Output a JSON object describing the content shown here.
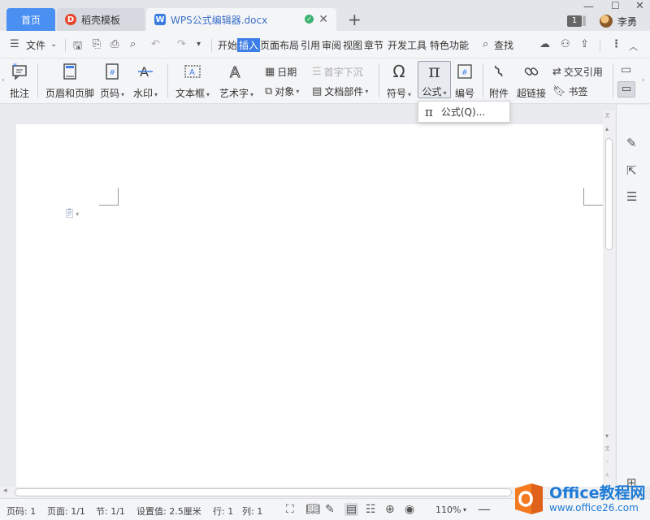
{
  "titlebar": {
    "tabs": [
      {
        "label": "首页"
      },
      {
        "label": "稻壳模板"
      },
      {
        "label": "WPS公式编辑器.docx"
      }
    ],
    "new_tab": "+",
    "badge": "1",
    "user_name": "李勇"
  },
  "menubar": {
    "file": "文件",
    "tabs": [
      "开始",
      "插入",
      "页面布局",
      "引用",
      "审阅",
      "视图",
      "章节",
      "开发工具",
      "特色功能"
    ],
    "active_tab": "插入",
    "search": "查找"
  },
  "ribbon": {
    "items": {
      "comment": "批注",
      "header_footer": "页眉和页脚",
      "page_number": "页码",
      "watermark": "水印",
      "textbox": "文本框",
      "wordart": "艺术字",
      "date": "日期",
      "object": "对象",
      "drop_cap": "首字下沉",
      "doc_parts": "文档部件",
      "symbol": "符号",
      "formula": "公式",
      "numbering": "编号",
      "attachment": "附件",
      "hyperlink": "超链接",
      "cross_reference": "交叉引用",
      "bookmark": "书签"
    }
  },
  "dropdown": {
    "item": "公式(Q)..."
  },
  "statusbar": {
    "page": "页码: 1",
    "pages": "页面: 1/1",
    "section": "节: 1/1",
    "setting": "设置值: 2.5厘米",
    "row": "行: 1",
    "col": "列: 1",
    "zoom": "110%"
  },
  "watermark": {
    "line1": "Office教程网",
    "line2": "www.office26.com"
  },
  "colors": {
    "accent": "#3d7de6",
    "home_tab": "#4a8ff2",
    "watermark_blue": "#1e7bd6",
    "watermark_orange": "#f47a20"
  }
}
